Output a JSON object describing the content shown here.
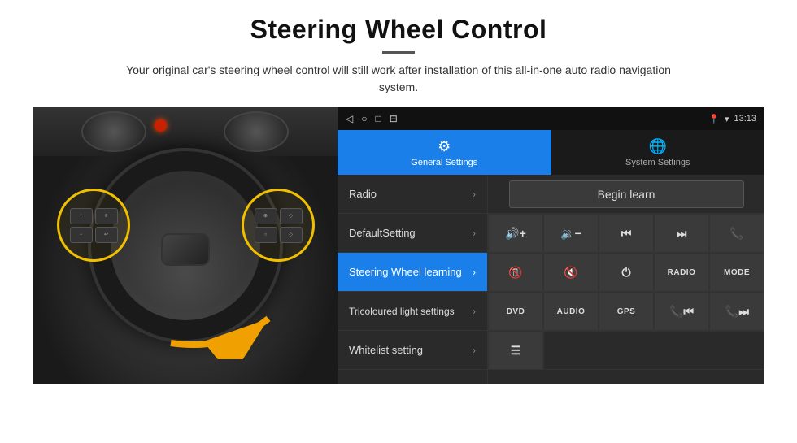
{
  "header": {
    "title": "Steering Wheel Control",
    "divider": true,
    "subtitle": "Your original car's steering wheel control will still work after installation of this all-in-one auto radio navigation system."
  },
  "status_bar": {
    "time": "13:13",
    "icons": [
      "◁",
      "○",
      "□",
      "⊟"
    ]
  },
  "tabs": [
    {
      "id": "general",
      "label": "General Settings",
      "icon": "⚙",
      "active": true
    },
    {
      "id": "system",
      "label": "System Settings",
      "icon": "🌐",
      "active": false
    }
  ],
  "menu_items": [
    {
      "id": "radio",
      "label": "Radio",
      "active": false
    },
    {
      "id": "default",
      "label": "DefaultSetting",
      "active": false
    },
    {
      "id": "steering",
      "label": "Steering Wheel learning",
      "active": true
    },
    {
      "id": "tricoloured",
      "label": "Tricoloured light settings",
      "active": false
    },
    {
      "id": "whitelist",
      "label": "Whitelist setting",
      "active": false
    }
  ],
  "begin_learn": {
    "label": "Begin learn"
  },
  "control_buttons": {
    "row1": [
      {
        "id": "vol-up",
        "label": "🔊+",
        "type": "icon"
      },
      {
        "id": "vol-down",
        "label": "🔉−",
        "type": "icon"
      },
      {
        "id": "prev",
        "label": "⏮",
        "type": "icon"
      },
      {
        "id": "next",
        "label": "⏭",
        "type": "icon"
      },
      {
        "id": "phone",
        "label": "📞",
        "type": "icon"
      }
    ],
    "row2": [
      {
        "id": "hang-up",
        "label": "📵",
        "type": "icon"
      },
      {
        "id": "mute",
        "label": "🔇×",
        "type": "icon"
      },
      {
        "id": "power",
        "label": "⏻",
        "type": "icon"
      },
      {
        "id": "radio-btn",
        "label": "RADIO",
        "type": "text"
      },
      {
        "id": "mode-btn",
        "label": "MODE",
        "type": "text"
      }
    ],
    "row3": [
      {
        "id": "dvd-btn",
        "label": "DVD",
        "type": "text"
      },
      {
        "id": "audio-btn",
        "label": "AUDIO",
        "type": "text"
      },
      {
        "id": "gps-btn",
        "label": "GPS",
        "type": "text"
      },
      {
        "id": "tel-prev",
        "label": "📞⏮",
        "type": "icon"
      },
      {
        "id": "tel-next",
        "label": "📞⏭",
        "type": "icon"
      }
    ],
    "row4_single": {
      "id": "settings-icon",
      "label": "☰",
      "type": "icon"
    }
  }
}
